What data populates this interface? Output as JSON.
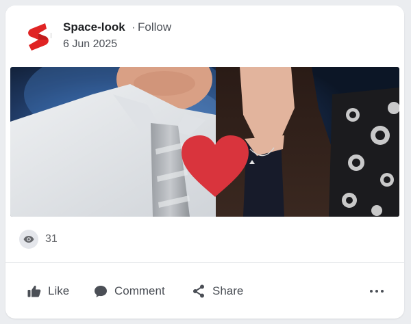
{
  "post": {
    "page_name": "Space-look",
    "separator": "·",
    "follow_label": "Follow",
    "date": "6 Jun 2025"
  },
  "stats": {
    "views": "31"
  },
  "actions": {
    "like_label": "Like",
    "comment_label": "Comment",
    "share_label": "Share"
  },
  "icons": {
    "logo": "space-look-logo",
    "views": "eye-icon",
    "like": "thumbs-up-icon",
    "comment": "comment-icon",
    "share": "share-icon",
    "more": "more-icon"
  },
  "colors": {
    "brand_red": "#e02424",
    "heart": "#d9343d",
    "text": "#1c1e21",
    "muted": "#65676b"
  }
}
